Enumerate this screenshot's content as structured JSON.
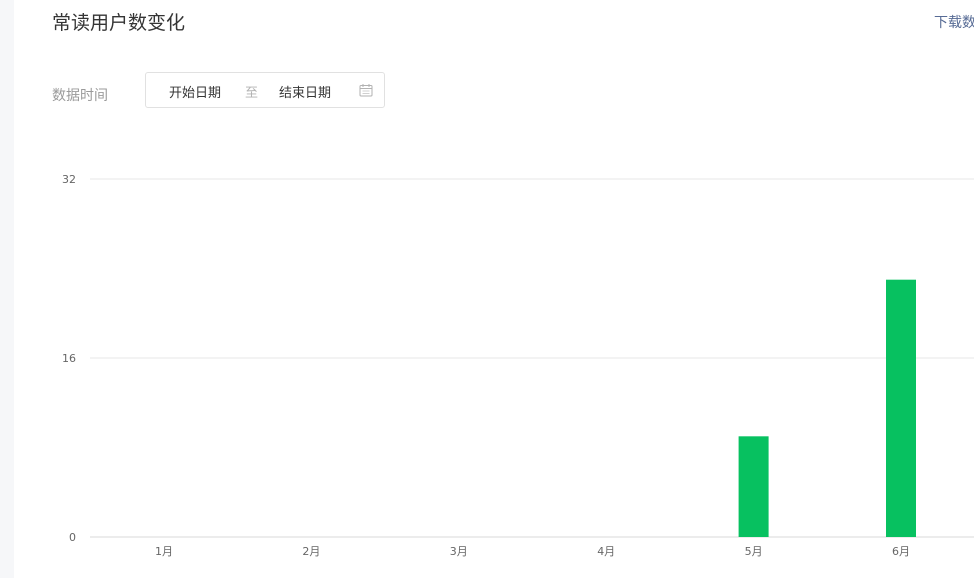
{
  "header": {
    "title": "常读用户数变化",
    "download_label": "下载数"
  },
  "filter": {
    "label": "数据时间",
    "start_placeholder": "开始日期",
    "separator": "至",
    "end_placeholder": "结束日期",
    "calendar_icon": "calendar-icon"
  },
  "colors": {
    "bar": "#07c160",
    "grid": "#e7e7e7",
    "link": "#576b95"
  },
  "chart_data": {
    "type": "bar",
    "categories": [
      "1月",
      "2月",
      "3月",
      "4月",
      "5月",
      "6月"
    ],
    "values": [
      0,
      0,
      0,
      0,
      9,
      23
    ],
    "yticks": [
      "32",
      "16",
      "0"
    ],
    "ylim": [
      0,
      32
    ],
    "grid": true
  }
}
